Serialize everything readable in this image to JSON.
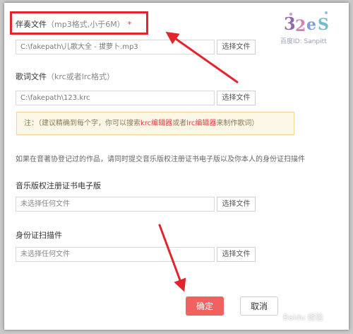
{
  "accompaniment": {
    "label": "伴奏文件",
    "hint": "（mp3格式,小于6M）",
    "required_mark": "*",
    "value": "C:\\fakepath\\儿歌大全 - 拔萝卜.mp3",
    "button": "选择文件"
  },
  "lyrics": {
    "label": "歌词文件",
    "hint": "（krc或者lrc格式）",
    "value": "C:\\fakepath\\123.krc",
    "button": "选择文件"
  },
  "note": {
    "prefix": "注：（建议精确到每个字，你可以搜索",
    "kw1": "krc编辑器",
    "middle": "或者",
    "kw2": "lrc编辑器",
    "suffix": "来制作歌词）"
  },
  "info_text": "如果在音著协登记过的作品，请同时提交音乐版权注册证书电子版以及你本人的身份证扫描件",
  "copyright": {
    "label": "音乐版权注册证书电子版",
    "placeholder": "未选择任何文件",
    "button": "选择文件"
  },
  "idcard": {
    "label": "身份证扫描件",
    "placeholder": "未选择任何文件",
    "button": "选择文件"
  },
  "actions": {
    "confirm": "确定",
    "cancel": "取消"
  },
  "watermark_logo": {
    "text": "百度ID: Sanpitt"
  },
  "watermark": "Baidu 经验",
  "colors": {
    "highlight": "#e3242b",
    "confirm": "#f06260",
    "note_bg": "#fdf7e8",
    "keyword": "#e4393c"
  }
}
